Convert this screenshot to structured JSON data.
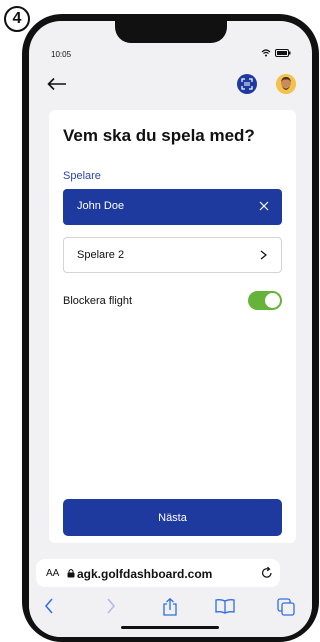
{
  "step_badge": "4",
  "status": {
    "time": "10:05"
  },
  "colors": {
    "primary": "#1f3a9e",
    "toggle_on": "#66b33a",
    "link": "#2a46a8"
  },
  "header": {
    "back_icon": "arrow-left-icon",
    "scan_icon": "scan-code-icon",
    "avatar_icon": "avatar-icon"
  },
  "card": {
    "title": "Vem ska du spela med?",
    "section_label": "Spelare",
    "players": [
      {
        "name": "John Doe",
        "selected": true,
        "action_icon": "close-icon"
      },
      {
        "name": "Spelare 2",
        "selected": false,
        "action_icon": "chevron-right-icon"
      }
    ],
    "block_flight_label": "Blockera flight",
    "block_flight_on": true,
    "next_button": "Nästa"
  },
  "browser": {
    "aa_label": "AA",
    "url": "agk.golfdashboard.com",
    "icons": [
      "back-icon",
      "forward-icon",
      "share-icon",
      "bookmarks-icon",
      "tabs-icon"
    ]
  }
}
